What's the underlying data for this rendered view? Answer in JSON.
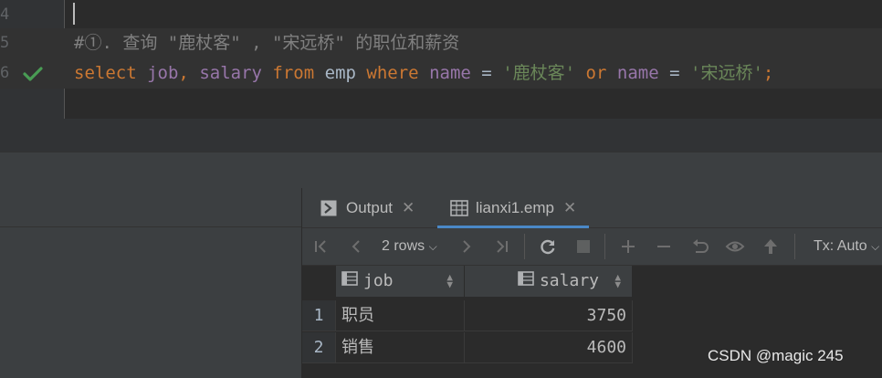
{
  "editor": {
    "lines": [
      {
        "number": "4"
      },
      {
        "number": "5",
        "comment": "#①. 查询 \"鹿杖客\" , \"宋远桥\" 的职位和薪资"
      },
      {
        "number": "6",
        "tokens": {
          "select": "select",
          "col_job": "job",
          "comma": ",",
          "col_salary": "salary",
          "from": "from",
          "table": "emp",
          "where": "where",
          "col_name1": "name",
          "eq1": "=",
          "val1": "'鹿杖客'",
          "or": "or",
          "col_name2": "name",
          "eq2": "=",
          "val2": "'宋远桥'",
          "semi": ";"
        }
      }
    ]
  },
  "results": {
    "tabs": [
      {
        "label": "Output",
        "icon": "console-icon"
      },
      {
        "label": "lianxi1.emp",
        "icon": "table-icon"
      }
    ],
    "toolbar": {
      "rows_label": "2 rows",
      "tx_label": "Tx: Auto"
    },
    "columns": [
      "job",
      "salary"
    ],
    "rows": [
      {
        "num": "1",
        "job": "职员",
        "salary": "3750"
      },
      {
        "num": "2",
        "job": "销售",
        "salary": "4600"
      }
    ]
  },
  "watermark": "CSDN @magic 245",
  "colors": {
    "background": "#2b2b2b",
    "keyword": "#cc7832",
    "field": "#9876aa",
    "string": "#6a8759",
    "comment": "#808080",
    "check": "#499c54",
    "active_tab_underline": "#4a88c7"
  }
}
